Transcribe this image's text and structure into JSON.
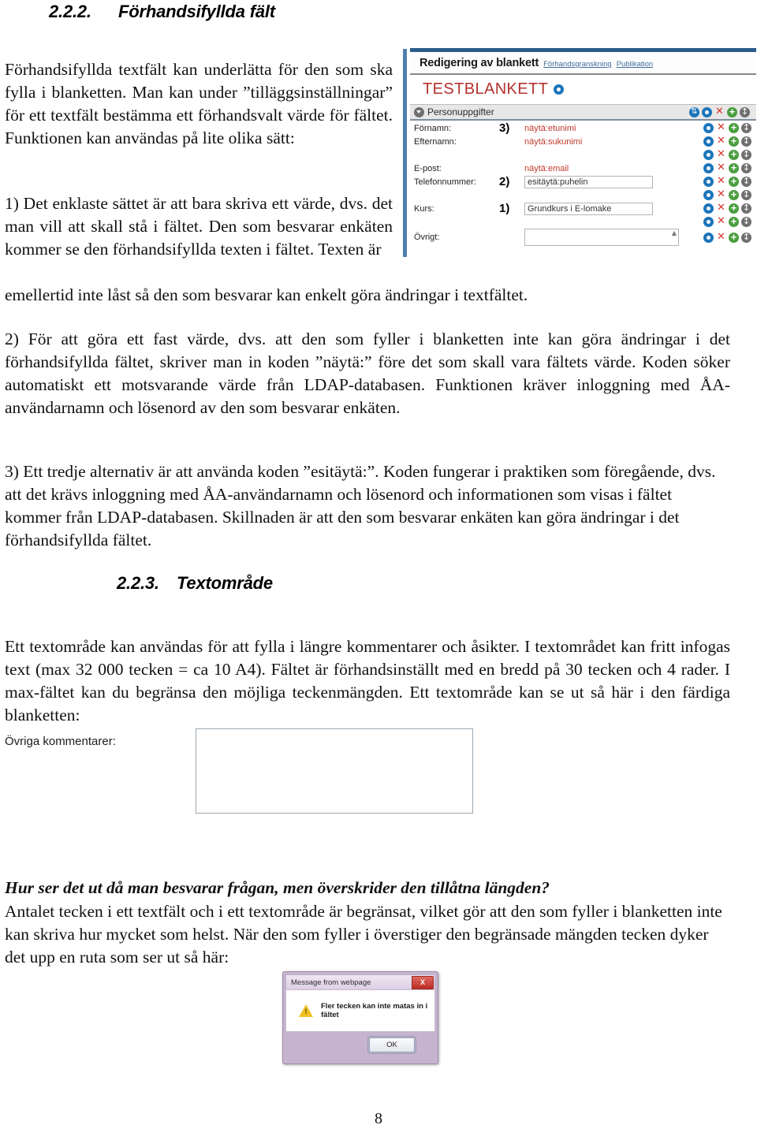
{
  "document": {
    "page_number": "8"
  },
  "sections": {
    "prefilled": {
      "number": "2.2.2.",
      "title": "Förhandsifyllda fält",
      "intro": "Förhandsifyllda textfält kan underlätta för den som ska fylla i blanketten. Man kan under ”tilläggsinställningar” för ett textfält bestämma ett förhandsvalt värde för fältet. Funktionen kan användas på lite olika sätt:",
      "item1_head": "1) Det enklaste sättet är att bara skriva ett värde, dvs. det man vill att skall stå i fältet. Den som besvarar enkäten kommer se den förhandsifyllda texten i fältet. Texten är",
      "item1_tail": "emellertid inte låst så den som besvarar kan enkelt göra ändringar i textfältet.",
      "item2": "2) För att göra ett fast värde, dvs. att den som fyller i blanketten inte kan göra ändringar i det förhandsifyllda fältet, skriver man in koden ”näytä:” före det som skall vara fältets värde. Koden söker automatiskt ett motsvarande värde från LDAP-databasen. Funktionen kräver inloggning med ÅA-användarnamn och lösenord av den som besvarar enkäten.",
      "item3": "3) Ett tredje alternativ är att använda koden ”esitäytä:”. Koden fungerar i praktiken som föregående, dvs. att det krävs inloggning med ÅA-användarnamn och lösenord och informationen som visas i fältet kommer från LDAP-databasen. Skillnaden är att den som besvarar enkäten kan göra ändringar i det förhandsifyllda fältet."
    },
    "textarea": {
      "number": "2.2.3.",
      "title": "Textområde",
      "body": "Ett textområde kan användas för att fylla i längre kommentarer och åsikter. I textområdet kan fritt infogas text (max 32 000 tecken = ca 10 A4). Fältet är förhandsinställt med en bredd på 30 tecken och 4 rader. I max-fältet kan du begränsa den möjliga teckenmängden. Ett textområde kan se ut så här i den färdiga blanketten:"
    },
    "limit": {
      "question": "Hur ser det ut då man besvarar frågan, men överskrider den tillåtna längden?",
      "body": "Antalet tecken i ett textfält och i ett textområde är begränsat, vilket gör att den som fyller i blanketten inte kan skriva hur mycket som helst. När den som fyller i överstiger den begränsade mängden tecken dyker det upp en ruta som ser ut så här:"
    }
  },
  "editor_screenshot": {
    "toolbar_title": "Redigering av blankett",
    "link_preview": "Förhandsgranskning",
    "link_publish": "Publikation",
    "form_title": "TESTBLANKETT",
    "section_label": "Personuppgifter",
    "fields": [
      {
        "label": "Förnamn:",
        "marker": "3)",
        "value": "näytä:etunimi",
        "kind": "code"
      },
      {
        "label": "Efternamn:",
        "marker": "",
        "value": "näytä:sukunimi",
        "kind": "code"
      },
      {
        "label": "E-post:",
        "marker": "",
        "value": "näytä:email",
        "kind": "code"
      },
      {
        "label": "Telefonnummer:",
        "marker": "2)",
        "value": "esitäytä:puhelin",
        "kind": "input"
      },
      {
        "label": "Kurs:",
        "marker": "1)",
        "value": "Grundkurs i E-lomake",
        "kind": "input"
      },
      {
        "label": "Övrigt:",
        "marker": "",
        "value": "",
        "kind": "textarea"
      }
    ],
    "icons": [
      "sort-icon",
      "edit-icon",
      "delete-icon",
      "add-icon",
      "move-icon"
    ],
    "colors": {
      "code_value": "#c0392b",
      "form_title": "#b4322e",
      "icon_blue": "#1b75bb",
      "icon_red": "#d8342a",
      "icon_green": "#4a9e3f",
      "icon_gray": "#6f6f6f"
    }
  },
  "textarea_example": {
    "label": "Övriga kommentarer:",
    "value": ""
  },
  "dialog": {
    "title": "Message from webpage",
    "close_label": "X",
    "message": "Fler tecken kan inte matas in i fältet",
    "ok_label": "OK"
  }
}
